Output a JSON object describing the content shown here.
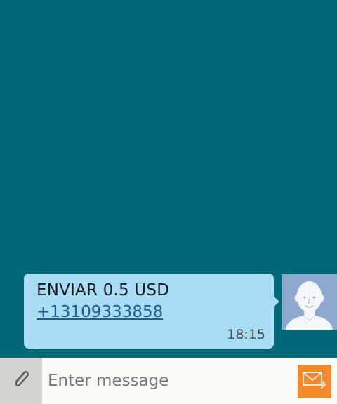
{
  "message": {
    "text": "ENVIAR 0.5 USD",
    "phone_link": "+13109333858",
    "time": "18:15"
  },
  "input": {
    "placeholder": "Enter message"
  },
  "icons": {
    "avatar": "contact-avatar-icon",
    "attach": "paperclip-icon",
    "send": "send-envelope-icon"
  },
  "colors": {
    "background": "#006978",
    "bubble": "#a9dcf5",
    "send_button": "#f2892b",
    "avatar_bg": "#8fa8cf"
  }
}
